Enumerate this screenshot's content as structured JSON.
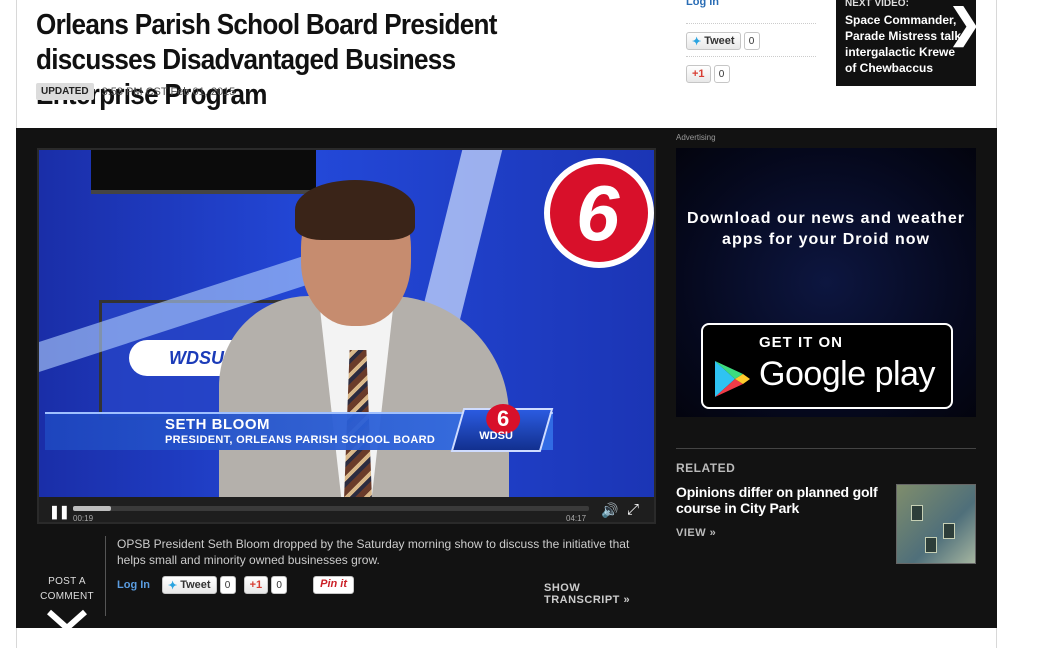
{
  "article": {
    "headline": "Orleans Parish School Board President discusses Disadvantaged Business Enterprise Program",
    "updated_badge": "UPDATED",
    "updated_time": "3:53 PM CST Feb 01, 2015"
  },
  "share_top": {
    "login": "Log In",
    "tweet_label": "Tweet",
    "tweet_count": "0",
    "gplus_label": "+1",
    "gplus_count": "0"
  },
  "next_video": {
    "label": "NEXT VIDEO:",
    "title": "Space Commander, Parade Mistress talk intergalactic Krewe of Chewbaccus"
  },
  "video": {
    "lower_third_name": "SETH BLOOM",
    "lower_third_role": "PRESIDENT, ORLEANS PARISH SCHOOL BOARD",
    "station_logo": "WDSU",
    "channel_number": "6",
    "time_elapsed": "00:19",
    "time_total": "04:17",
    "progress_fraction": 0.074,
    "caption": "OPSB President Seth Bloom dropped by the Saturday morning show to discuss the initiative that helps small and minority owned businesses grow.",
    "login": "Log In",
    "tweet_label": "Tweet",
    "tweet_count": "0",
    "gplus_label": "+1",
    "gplus_count": "0",
    "pinit_label": "Pin it",
    "show_transcript": "SHOW TRANSCRIPT »"
  },
  "post_comment": {
    "line1": "POST A",
    "line2": "COMMENT"
  },
  "advertising": {
    "label": "Advertising",
    "headline": "Download our news and weather apps for your Droid now",
    "get_it_on": "GET IT ON",
    "store_name": "Google play"
  },
  "related": {
    "heading": "RELATED",
    "title": "Opinions differ on planned golf course in City Park",
    "view": "VIEW »"
  },
  "colors": {
    "dark_band": "#121212",
    "link_blue": "#2a6db5",
    "gplus_red": "#d73d32",
    "pinterest_red": "#cb2027",
    "wdsu_red": "#d8102a"
  }
}
